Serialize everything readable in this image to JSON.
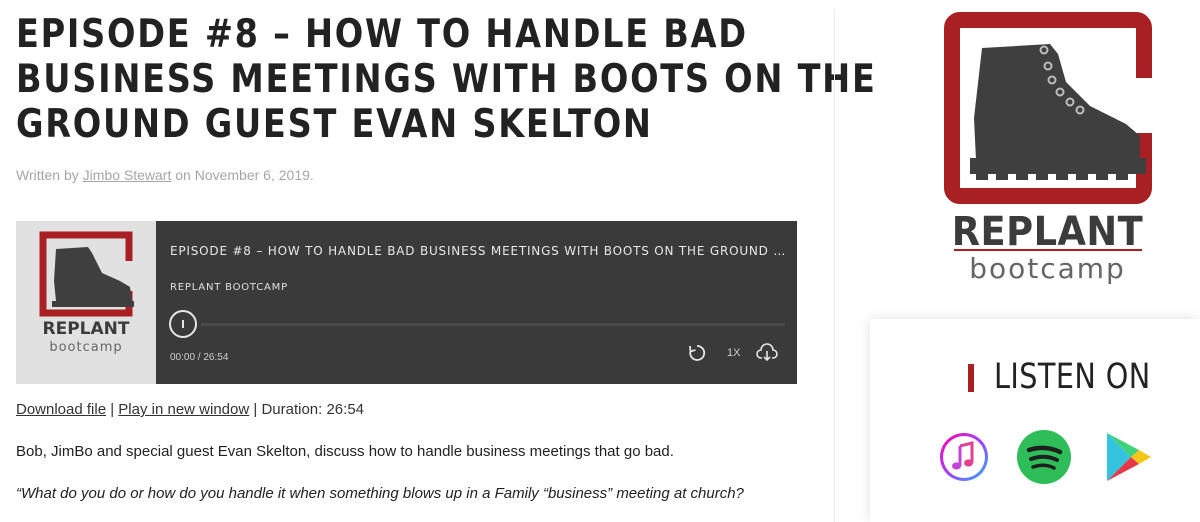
{
  "post": {
    "title_lines": [
      "EPISODE #8 – HOW TO HANDLE BAD",
      "BUSINESS MEETINGS WITH BOOTS ON THE",
      "GROUND GUEST EVAN SKELTON"
    ],
    "byline_prefix": "Written by ",
    "author": "Jimbo Stewart",
    "byline_suffix": " on November 6, 2019."
  },
  "player": {
    "episode_title": "EPISODE #8 – HOW TO HANDLE BAD BUSINESS MEETINGS WITH BOOTS ON THE GROUND …",
    "show_name": "REPLANT BOOTCAMP",
    "time": "00:00 / 26:54",
    "speed": "1X",
    "progress": 0,
    "icons": {
      "play": "play-icon",
      "rewind": "rewind-icon",
      "download": "download-icon"
    }
  },
  "links": {
    "download": "Download file",
    "separator": " | ",
    "play_new_window": "Play in new window",
    "duration": "Duration: 26:54"
  },
  "content": {
    "description": "Bob, JimBo and special guest Evan Skelton, discuss how to handle business meetings that go bad.",
    "quote": "“What do you do or how do you handle it when something blows up in a Family “business” meeting at church?"
  },
  "sidebar": {
    "logo_word": "REPLANT",
    "logo_sub": "bootcamp",
    "listen_title": "LISTEN ON",
    "platforms": [
      "apple-podcasts-icon",
      "spotify-icon",
      "google-play-icon"
    ]
  },
  "colors": {
    "brand_red": "#a81f24",
    "player_bg": "#3a3a3a",
    "boot": "#3f3f3f"
  }
}
